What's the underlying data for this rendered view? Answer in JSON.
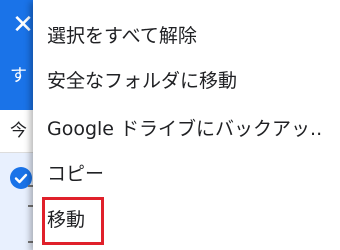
{
  "app": {
    "close_icon": "close-icon",
    "tab_label_partial": "す",
    "section_label_partial": "今",
    "accent_color": "#1a73e8"
  },
  "menu": {
    "items": [
      {
        "label": "選択をすべて解除"
      },
      {
        "label": "安全なフォルダに移動"
      },
      {
        "label": "Google ドライブにバックアッ.."
      },
      {
        "label": "コピー"
      },
      {
        "label": "移動"
      }
    ],
    "highlighted_item": "移動",
    "highlight_color": "#e0202a"
  }
}
